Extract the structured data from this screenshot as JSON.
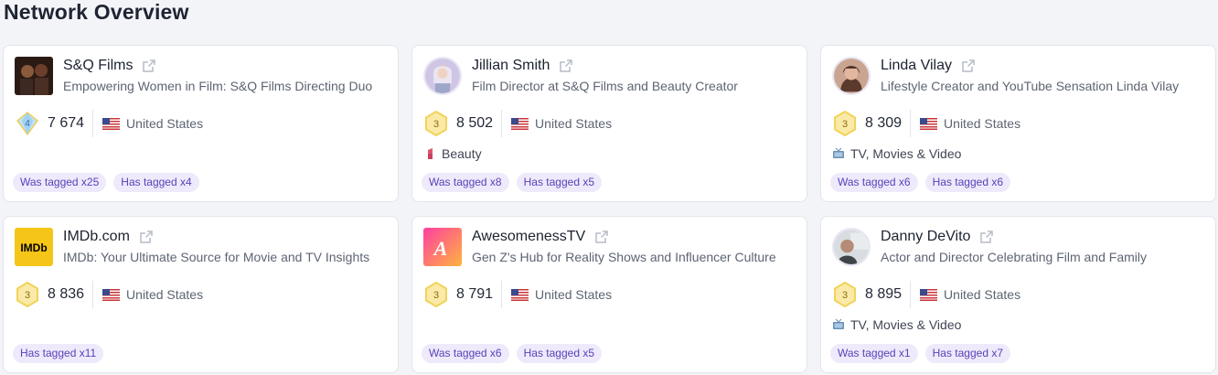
{
  "page": {
    "title": "Network Overview"
  },
  "colors": {
    "tag_bg": "#eeeafb",
    "tag_text": "#5b3fb8",
    "badge_gold": "#f1d35a",
    "badge_diamond": "#9fd2f2"
  },
  "cards": [
    {
      "name": "S&Q Films",
      "description": "Empowering Women in Film: S&Q Films Directing Duo",
      "level": "4",
      "score": "7 674",
      "country": "United States",
      "category": "",
      "tags": [
        "Was tagged x25",
        "Has tagged x4"
      ]
    },
    {
      "name": "Jillian Smith",
      "description": "Film Director at S&Q Films and Beauty Creator",
      "level": "3",
      "score": "8 502",
      "country": "United States",
      "category": "Beauty",
      "tags": [
        "Was tagged x8",
        "Has tagged x5"
      ]
    },
    {
      "name": "Linda Vilay",
      "description": "Lifestyle Creator and YouTube Sensation Linda Vilay",
      "level": "3",
      "score": "8 309",
      "country": "United States",
      "category": "TV, Movies & Video",
      "tags": [
        "Was tagged x6",
        "Has tagged x6"
      ]
    },
    {
      "name": "IMDb.com",
      "description": "IMDb: Your Ultimate Source for Movie and TV Insights",
      "logo_text": "IMDb",
      "level": "3",
      "score": "8 836",
      "country": "United States",
      "category": "",
      "tags": [
        "Has tagged x11"
      ]
    },
    {
      "name": "AwesomenessTV",
      "description": "Gen Z's Hub for Reality Shows and Influencer Culture",
      "logo_text": "A",
      "level": "3",
      "score": "8 791",
      "country": "United States",
      "category": "",
      "tags": [
        "Was tagged x6",
        "Has tagged x5"
      ]
    },
    {
      "name": "Danny DeVito",
      "description": "Actor and Director Celebrating Film and Family",
      "level": "3",
      "score": "8 895",
      "country": "United States",
      "category": "TV, Movies & Video",
      "tags": [
        "Was tagged x1",
        "Has tagged x7"
      ]
    }
  ]
}
